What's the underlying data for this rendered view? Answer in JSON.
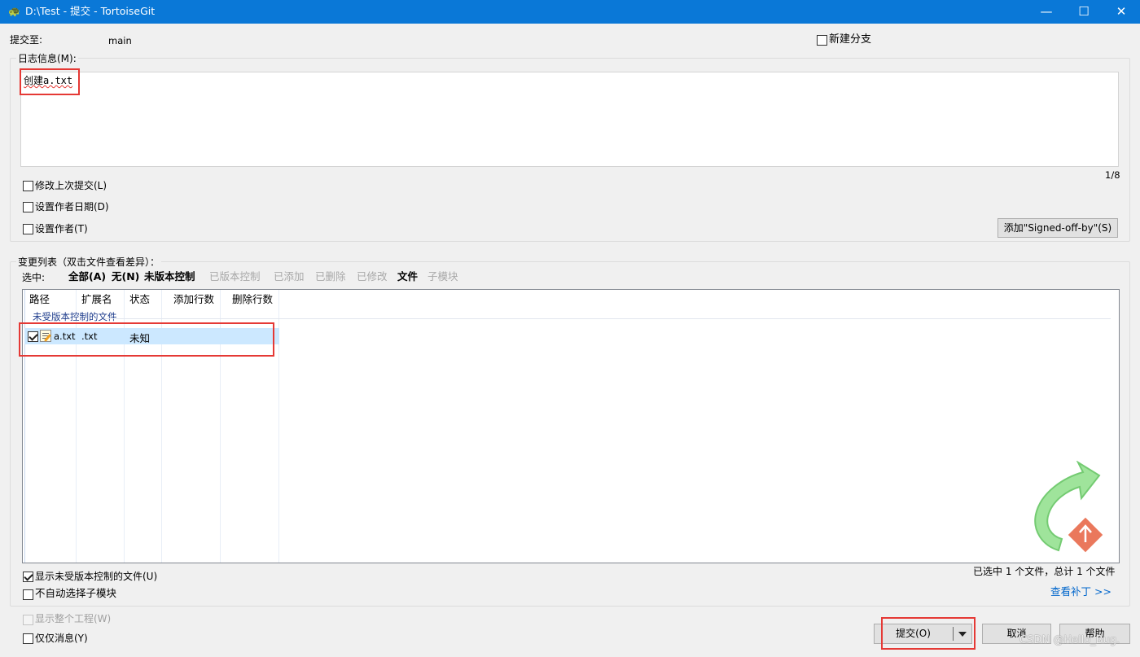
{
  "window": {
    "title": "D:\\Test - 提交 - TortoiseGit",
    "minimize_glyph": "—",
    "maximize_glyph": "☐",
    "close_glyph": "✕"
  },
  "commit_to": {
    "label": "提交至:",
    "branch": "main"
  },
  "new_branch": {
    "label": "新建分支",
    "checked": false
  },
  "log_message": {
    "group_label": "日志信息(M):",
    "text": "创建a.txt",
    "counter": "1/8"
  },
  "options": {
    "amend": "修改上次提交(L)",
    "set_date": "设置作者日期(D)",
    "set_author": "设置作者(T)",
    "signed_off_button": "添加\"Signed-off-by\"(S)"
  },
  "changes": {
    "group_label": "变更列表（双击文件查看差异）：",
    "select_label": "选中:",
    "filters": [
      {
        "label": "全部(A)",
        "enabled": true
      },
      {
        "label": "无(N)",
        "enabled": true
      },
      {
        "label": "未版本控制",
        "enabled": true
      },
      {
        "label": "已版本控制",
        "enabled": false
      },
      {
        "label": "已添加",
        "enabled": false
      },
      {
        "label": "已删除",
        "enabled": false
      },
      {
        "label": "已修改",
        "enabled": false
      },
      {
        "label": "文件",
        "enabled": true
      },
      {
        "label": "子模块",
        "enabled": false
      }
    ],
    "columns": [
      "路径",
      "扩展名",
      "状态",
      "添加行数",
      "删除行数"
    ],
    "group_header": "未受版本控制的文件",
    "rows": [
      {
        "checked": true,
        "path": "a.txt",
        "ext": ".txt",
        "status": "未知",
        "added": "",
        "deleted": ""
      }
    ],
    "show_unversioned": "显示未受版本控制的文件(U)",
    "no_auto_submodule": "不自动选择子模块",
    "summary": "已选中 1 个文件，总计 1 个文件",
    "view_patch": "查看补丁 >>"
  },
  "footer": {
    "show_whole_project": "显示整个工程(W)",
    "message_only": "仅仅消息(Y)",
    "commit_button": "提交(O)",
    "cancel_button": "取消",
    "help_button": "帮助",
    "watermark": "CSDN @Hello_Bug."
  },
  "colors": {
    "titlebar": "#0a78d7",
    "selection": "#cce8ff",
    "highlight_box": "#e53935",
    "link": "#0066cc"
  },
  "icons": {
    "app": "tortoise-icon",
    "file": "text-file-icon",
    "logo": "tortoisegit-logo",
    "dropdown": "dropdown-arrow-icon"
  }
}
